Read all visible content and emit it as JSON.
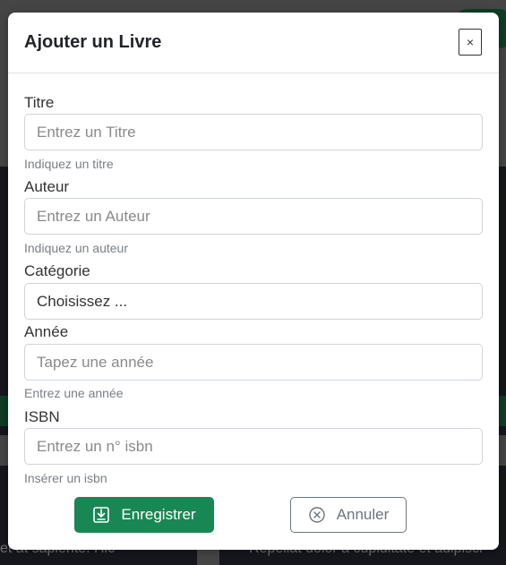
{
  "modal": {
    "title": "Ajouter un Livre",
    "close_label": "×"
  },
  "form": {
    "title": {
      "label": "Titre",
      "placeholder": "Entrez un Titre",
      "help": "Indiquez un titre"
    },
    "author": {
      "label": "Auteur",
      "placeholder": "Entrez un Auteur",
      "help": "Indiquez un auteur"
    },
    "category": {
      "label": "Catégorie",
      "selected": "Choisissez ..."
    },
    "year": {
      "label": "Année",
      "placeholder": "Tapez une année",
      "help": "Entrez une année"
    },
    "isbn": {
      "label": "ISBN",
      "placeholder": "Entrez un n° isbn",
      "help": "Insérer un isbn"
    }
  },
  "actions": {
    "save_label": "Enregistrer",
    "save_icon": "download-icon",
    "cancel_label": "Annuler",
    "cancel_icon": "circle-x-icon"
  },
  "background": {
    "bottom_left_text": "et at sapiente. Hic",
    "bottom_right_text": "Repellat dolor a cupiditate et adipisci"
  },
  "colors": {
    "primary_green": "#198754",
    "overlay": "rgba(0,0,0,0.5)"
  }
}
